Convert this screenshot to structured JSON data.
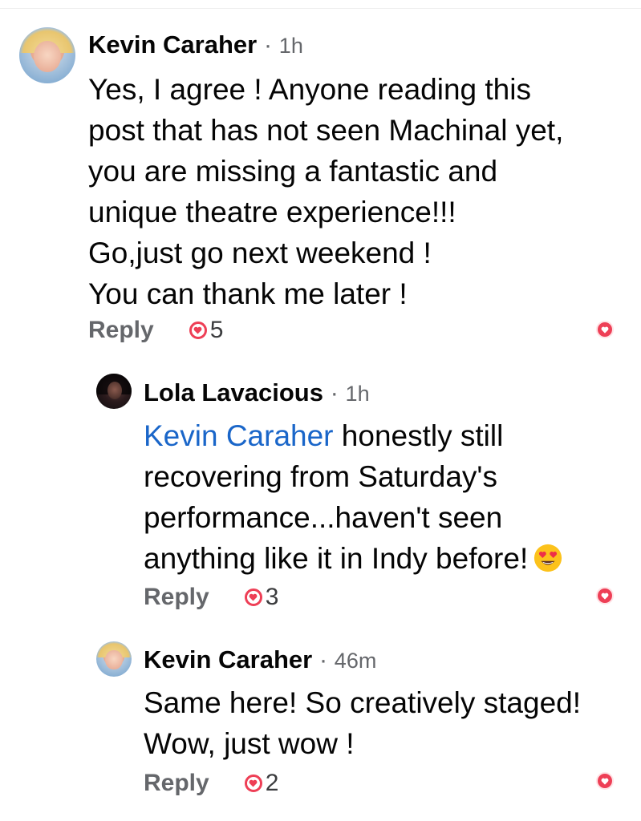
{
  "comments": [
    {
      "name": "Kevin Caraher",
      "separator": "·",
      "time": "1h",
      "lines": [
        "Yes, I agree ! Anyone reading this",
        "post that has not seen Machinal yet,",
        "you are missing a fantastic and",
        "unique theatre experience!!!",
        "Go,just go next weekend !",
        "You can thank me later !"
      ],
      "reply_label": "Reply",
      "reaction_count": "5"
    },
    {
      "name": "Lola Lavacious",
      "separator": "·",
      "time": "1h",
      "mention": "Kevin Caraher",
      "first_line_rest": " honestly still",
      "lines": [
        "recovering from Saturday's",
        "performance...haven't seen"
      ],
      "last_line": "anything like it in Indy before!",
      "emoji": "smiling-face-with-heart-eyes",
      "reply_label": "Reply",
      "reaction_count": "3"
    },
    {
      "name": "Kevin Caraher",
      "separator": "·",
      "time": "46m",
      "lines": [
        "Same here! So creatively staged!",
        "Wow, just wow !"
      ],
      "reply_label": "Reply",
      "reaction_count": "2"
    }
  ],
  "colors": {
    "heart": "#ee3f56",
    "mention": "#1a66c9",
    "meta": "#65676b"
  }
}
